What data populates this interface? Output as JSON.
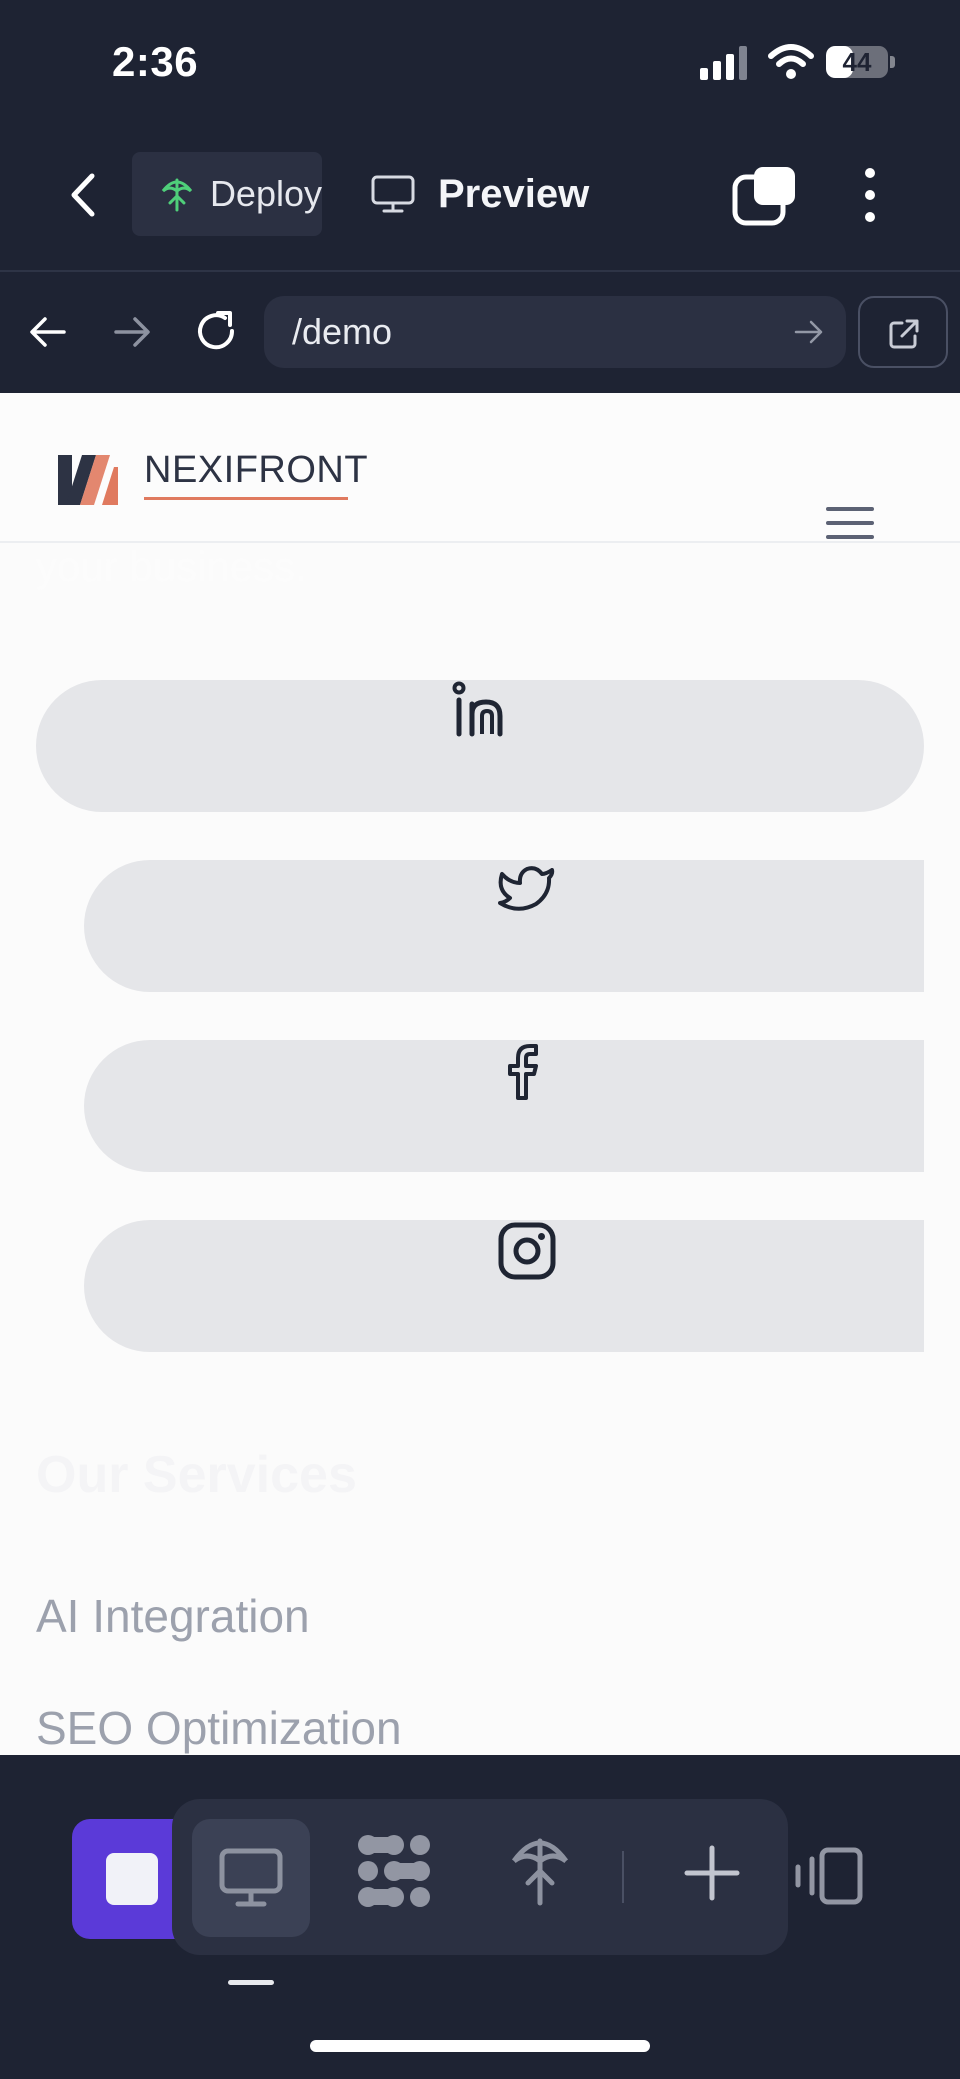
{
  "status_bar": {
    "time": "2:36",
    "battery": "44",
    "battery_fraction": 0.44
  },
  "toolbar": {
    "deploy_label": "Deploy",
    "preview_label": "Preview"
  },
  "browser": {
    "url": "/demo"
  },
  "site": {
    "brand": "NEXIFRONT",
    "hidden_line": "your business.",
    "social_links": [
      "linkedin-icon",
      "twitter-icon",
      "facebook-icon",
      "instagram-icon"
    ],
    "services_title": "Our Services",
    "services": [
      "AI Integration",
      "SEO Optimization"
    ]
  },
  "colors": {
    "accent": "#5b3ad8",
    "brand_orange": "#e07a5f",
    "dark_bg": "#1e2333"
  }
}
